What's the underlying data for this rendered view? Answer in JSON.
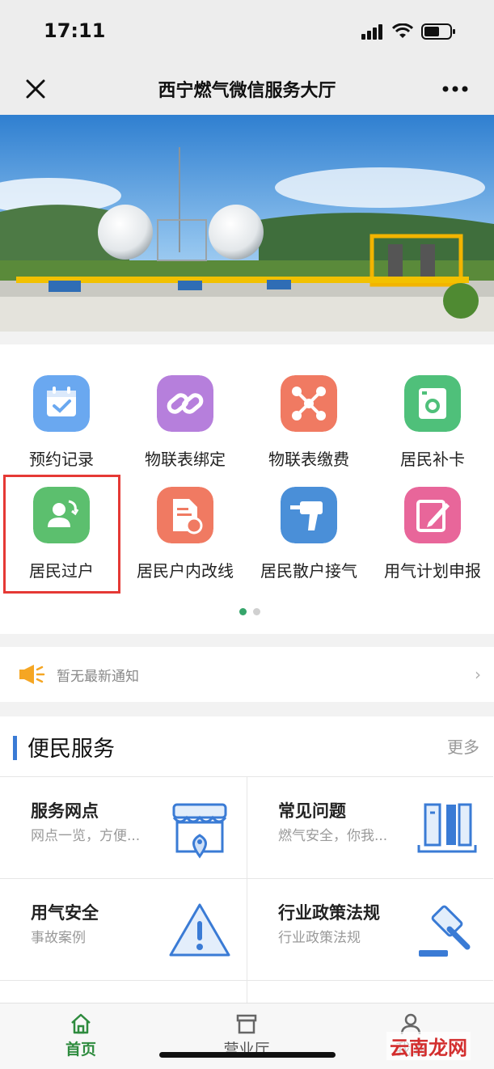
{
  "status_bar": {
    "time": "17:11"
  },
  "nav": {
    "title": "西宁燃气微信服务大厅"
  },
  "grid": [
    {
      "label": "预约记录",
      "icon": "calendar-check-icon",
      "color": "#6aa8f0"
    },
    {
      "label": "物联表绑定",
      "icon": "link-icon",
      "color": "#b67fdc"
    },
    {
      "label": "物联表缴费",
      "icon": "network-nodes-icon",
      "color": "#f07a62"
    },
    {
      "label": "居民补卡",
      "icon": "card-icon",
      "color": "#4fc07a"
    },
    {
      "label": "居民过户",
      "icon": "user-transfer-icon",
      "color": "#5cbf6e"
    },
    {
      "label": "居民户内改线",
      "icon": "document-edit-icon",
      "color": "#f07a62"
    },
    {
      "label": "居民散户接气",
      "icon": "drill-icon",
      "color": "#4a8fd8"
    },
    {
      "label": "用气计划申报",
      "icon": "pencil-note-icon",
      "color": "#e8669a"
    }
  ],
  "notice": {
    "text": "暂无最新通知"
  },
  "services": {
    "title": "便民服务",
    "more": "更多",
    "items": [
      {
        "title": "服务网点",
        "desc": "网点一览，方便...",
        "icon": "storefront-icon"
      },
      {
        "title": "常见问题",
        "desc": "燃气安全，你我...",
        "icon": "books-icon"
      },
      {
        "title": "用气安全",
        "desc": "事故案例",
        "icon": "warning-icon"
      },
      {
        "title": "行业政策法规",
        "desc": "行业政策法规",
        "icon": "gavel-icon"
      }
    ]
  },
  "tabbar": [
    {
      "label": "首页",
      "active": true
    },
    {
      "label": "营业厅",
      "active": false
    },
    {
      "label": "我的",
      "active": false
    }
  ],
  "watermark": "云南龙网",
  "colors": {
    "accent_green": "#2e8b3e",
    "highlight_red": "#e53935",
    "section_blue": "#3a7bd5"
  }
}
